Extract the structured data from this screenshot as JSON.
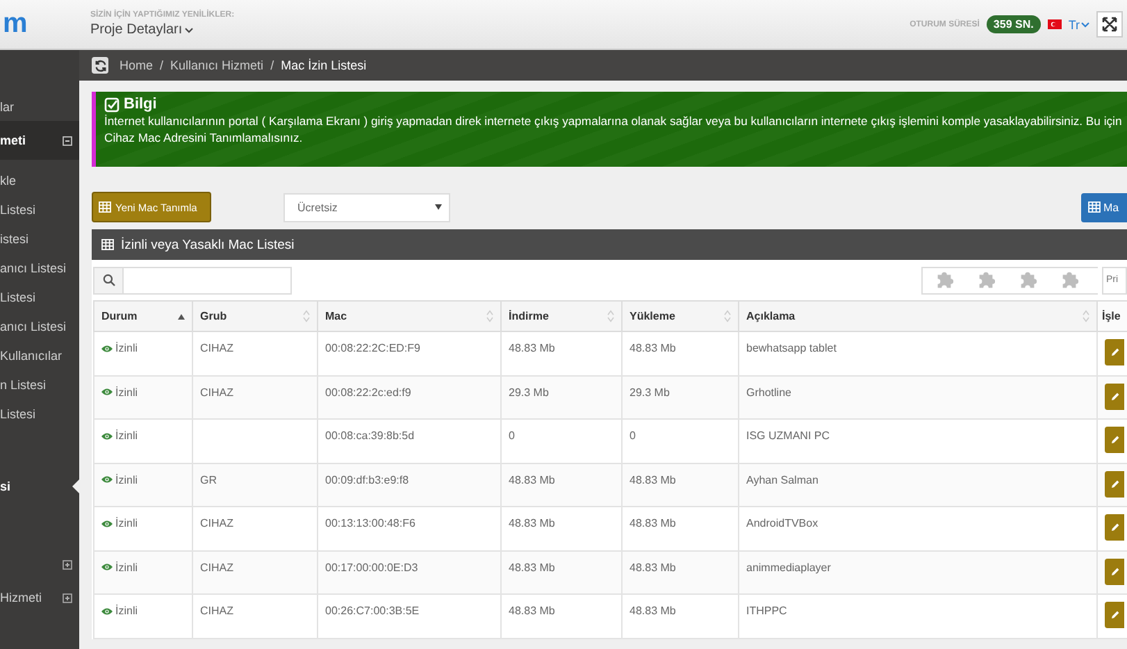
{
  "header": {
    "logo": "m",
    "news_label": "SİZİN İÇİN YAPTIĞIMIZ YENİLİKLER:",
    "project_menu": "Proje Detayları",
    "session_label": "OTURUM SÜRESİ",
    "session_badge": "359 SN.",
    "language": "Tr"
  },
  "breadcrumb": [
    {
      "label": "Home",
      "separator": "/"
    },
    {
      "label": "Kullanıcı Hizmeti",
      "separator": "/"
    },
    {
      "label": "Mac İzin Listesi"
    }
  ],
  "sidebar": {
    "items": [
      {
        "label": "lar",
        "kind": "link",
        "selected": false
      },
      {
        "label": "meti",
        "kind": "expanded_group",
        "selected": false
      },
      {
        "label": "kle",
        "kind": "link",
        "selected": false
      },
      {
        "label": "Listesi",
        "kind": "link",
        "selected": false
      },
      {
        "label": "istesi",
        "kind": "link",
        "selected": false
      },
      {
        "label": "anıcı Listesi",
        "kind": "link",
        "selected": false
      },
      {
        "label": "Listesi",
        "kind": "link",
        "selected": false
      },
      {
        "label": "anıcı Listesi",
        "kind": "link",
        "selected": false
      },
      {
        "label": "Kullanıcılar",
        "kind": "link",
        "selected": false
      },
      {
        "label": "n Listesi",
        "kind": "link",
        "selected": false
      },
      {
        "label": "Listesi",
        "kind": "link",
        "selected": false
      },
      {
        "label": "si",
        "kind": "link",
        "selected": true
      },
      {
        "kind": "collapsed_group",
        "selected": false
      },
      {
        "label": "Hizmeti",
        "kind": "collapsed_group",
        "selected": false
      }
    ]
  },
  "info": {
    "title": "Bilgi",
    "lines": [
      "İnternet kullanıcılarının portal ( Karşılama Ekranı ) giriş yapmadan direk internete çıkış yapmalarına olanak sağlar veya bu kullanıcıların internete çıkış işlemini komple yasaklayabilirsiniz. Bu için",
      "Cihaz Mac Adresini Tanımlamalısınız."
    ]
  },
  "actions": {
    "new_button": "Yeni Mac Tanımla",
    "plan_select": "Ücretsiz",
    "right_button": "Ma"
  },
  "panel": {
    "title": "İzinli veya Yasaklı Mac Listesi",
    "print_placeholder": "Pri"
  },
  "table": {
    "columns": [
      {
        "label": "Durum",
        "sortable": true,
        "sorted": true
      },
      {
        "label": "Grub",
        "sortable": true,
        "sorted": false
      },
      {
        "label": "Mac",
        "sortable": true,
        "sorted": false
      },
      {
        "label": "İndirme",
        "sortable": true,
        "sorted": false
      },
      {
        "label": "Yükleme",
        "sortable": true,
        "sorted": false
      },
      {
        "label": "Açıklama",
        "sortable": true,
        "sorted": false
      },
      {
        "label": "İşle",
        "sortable": false,
        "sorted": false
      }
    ],
    "rows": [
      {
        "status": "İzinli",
        "group": "CIHAZ",
        "mac": "00:08:22:2C:ED:F9",
        "download": "48.83 Mb",
        "upload": "48.83 Mb",
        "description": "bewhatsapp tablet"
      },
      {
        "status": "İzinli",
        "group": "CIHAZ",
        "mac": "00:08:22:2c:ed:f9",
        "download": "29.3 Mb",
        "upload": "29.3 Mb",
        "description": "Grhotline"
      },
      {
        "status": "İzinli",
        "mac": "00:08:ca:39:8b:5d",
        "download": "0",
        "upload": "0",
        "description": "ISG UZMANI PC"
      },
      {
        "status": "İzinli",
        "group": "GR",
        "mac": "00:09:df:b3:e9:f8",
        "download": "48.83 Mb",
        "upload": "48.83 Mb",
        "description": "Ayhan Salman"
      },
      {
        "status": "İzinli",
        "group": "CIHAZ",
        "mac": "00:13:13:00:48:F6",
        "download": "48.83 Mb",
        "upload": "48.83 Mb",
        "description": "AndroidTVBox"
      },
      {
        "status": "İzinli",
        "group": "CIHAZ",
        "mac": "00:17:00:00:0E:D3",
        "download": "48.83 Mb",
        "upload": "48.83 Mb",
        "description": "animmediaplayer"
      },
      {
        "status": "İzinli",
        "group": "CIHAZ",
        "mac": "00:26:C7:00:3B:5E",
        "download": "48.83 Mb",
        "upload": "48.83 Mb",
        "description": "ITHPPC"
      }
    ]
  }
}
